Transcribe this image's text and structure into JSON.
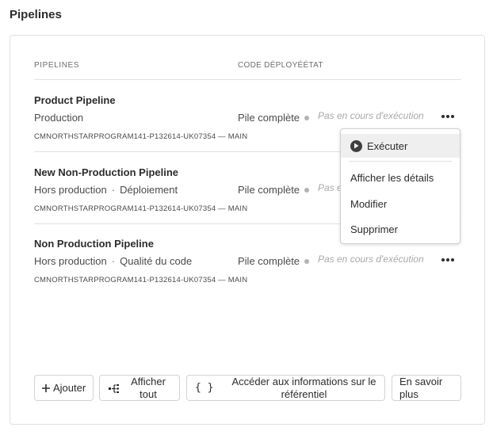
{
  "section_title": "Pipelines",
  "columns": {
    "pipelines": "PIPELINES",
    "code_deployed": "CODE DÉPLOYÉ",
    "status": "ÉTAT"
  },
  "pipelines": [
    {
      "name": "Product Pipeline",
      "type": "Production",
      "type_detail": "",
      "repo": "CMNORTHSTARPROGRAM141-P132614-UK07354 — MAIN",
      "deployed": "Pile complète",
      "status": "Pas en cours d'exécution"
    },
    {
      "name": "New Non-Production Pipeline",
      "type": "Hors production",
      "type_detail": "Déploiement",
      "repo": "CMNORTHSTARPROGRAM141-P132614-UK07354 — MAIN",
      "deployed": "Pile complète",
      "status": "Pas en cours d'exécution"
    },
    {
      "name": "Non Production Pipeline",
      "type": "Hors production",
      "type_detail": "Qualité du code",
      "repo": "CMNORTHSTARPROGRAM141-P132614-UK07354 — MAIN",
      "deployed": "Pile complète",
      "status": "Pas en cours d'exécution"
    }
  ],
  "context_menu": {
    "run": "Exécuter",
    "details": "Afficher les détails",
    "edit": "Modifier",
    "delete": "Supprimer"
  },
  "actions": {
    "add": "Ajouter",
    "show_all": "Afficher tout",
    "repo_info": "Accéder aux informations sur le référentiel",
    "learn_more": "En savoir plus"
  }
}
